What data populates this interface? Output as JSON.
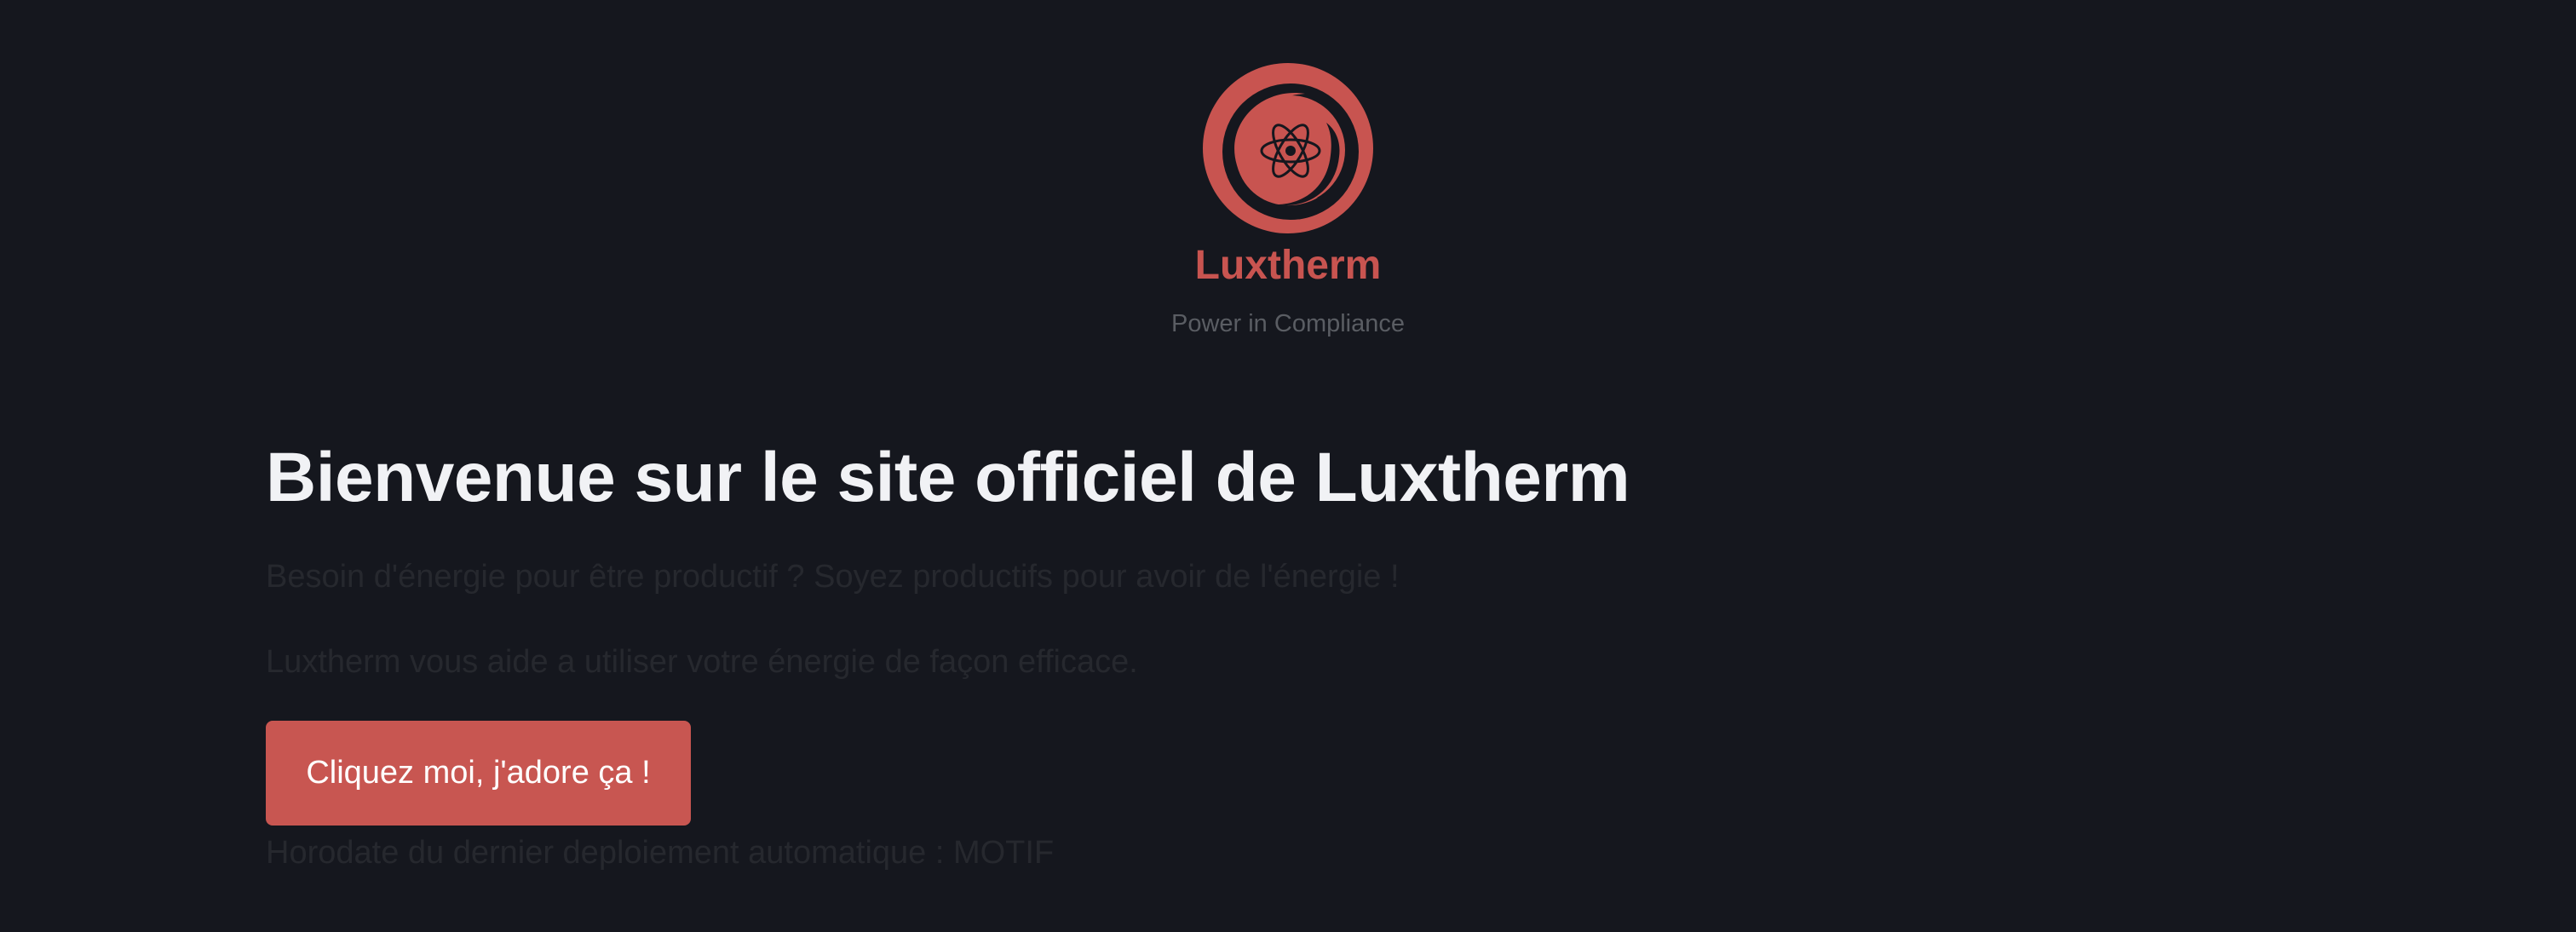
{
  "brand": {
    "name": "Luxtherm",
    "tagline": "Power in Compliance",
    "logo_icon": "atom-swirl-logo",
    "accent_color": "#c85450"
  },
  "main": {
    "heading": "Bienvenue sur le site officiel de Luxtherm",
    "paragraph_1": "Besoin d'énergie pour être productif ? Soyez productifs pour avoir de l'énergie !",
    "paragraph_2": "Luxtherm vous aide a utiliser votre énergie de façon efficace.",
    "cta_label": "Cliquez moi, j'adore ça !",
    "deploy_text": "Horodate du dernier deploiement automatique : MOTIF"
  },
  "colors": {
    "background": "#15171e",
    "heading": "#f1f2f5",
    "muted_text": "#26282e",
    "button": "#c85651"
  }
}
